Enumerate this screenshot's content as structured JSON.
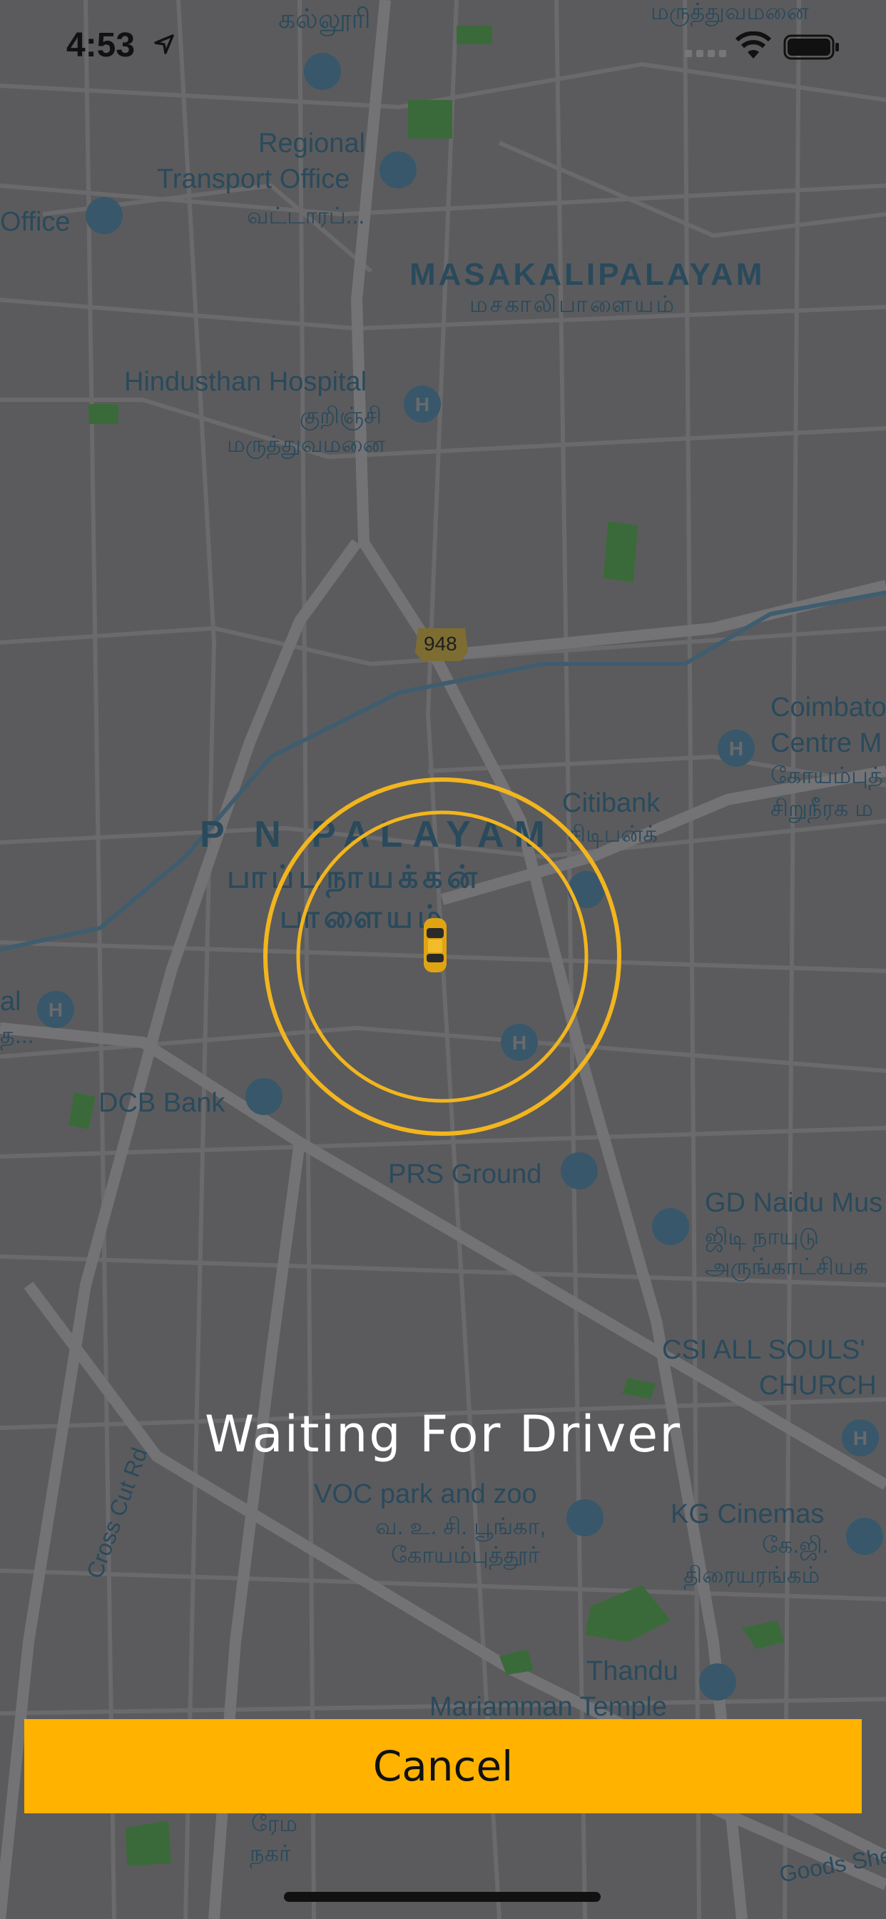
{
  "status_bar": {
    "time": "4:53"
  },
  "map": {
    "labels": {
      "top_tamil": "கல்லூரி",
      "top_right_tamil": "மருத்துவமனை",
      "regional_transport_line1": "Regional",
      "regional_transport_line2": "Transport Office",
      "regional_transport_tamil": "வட்டாரப்...",
      "office_left": "Office",
      "masakalipalayam": "MASAKALIPALAYAM",
      "masakalipalayam_tamil": "மசகாலிபாளையம்",
      "hindusthan_hospital": "Hindusthan Hospital",
      "hindusthan_tamil1": "குறிஞ்சி",
      "hindusthan_tamil2": "மருத்துவமனை",
      "road_number": "948",
      "coimbatore_line1": "Coimbato",
      "coimbatore_line2": "Centre M",
      "coimbatore_tamil1": "கோயம்புத்",
      "coimbatore_tamil2": "சிறுநீரக ம",
      "citibank": "Citibank",
      "citibank_tamil": "சிடிபன்க்",
      "pn_palayam": "P N PALAYAM",
      "pn_palayam_tamil1": "பாப்பநாயக்கன்",
      "pn_palayam_tamil2": "பாளையம்",
      "left_cut": "al",
      "left_cut2": "த...",
      "dcb_bank": "DCB Bank",
      "prs_ground": "PRS Ground",
      "gd_naidu": "GD Naidu Mus",
      "gd_naidu_tamil1": "ஜிடி நாயுடு",
      "gd_naidu_tamil2": "அருங்காட்சியக",
      "csi_line1": "CSI ALL SOULS'",
      "csi_line2": "CHURCH",
      "voc_park": "VOC park and zoo",
      "voc_tamil1": "வ. உ. சி. பூங்கா,",
      "voc_tamil2": "கோயம்புத்தூர்",
      "kg_cinemas": "KG Cinemas",
      "kg_tamil1": "கே.ஜி.",
      "kg_tamil2": "திரையரங்கம்",
      "cross_cut": "Cross Cut Rd",
      "thandu": "Thandu",
      "mariamman": "Mariamman Temple",
      "bottom_tamil1": "ரேம",
      "bottom_tamil2": "நகர்",
      "goods_shed": "Goods She"
    }
  },
  "ride": {
    "status_text": "Waiting For Driver",
    "cancel_label": "Cancel"
  },
  "colors": {
    "accent": "#FFB300",
    "overlay": "#5b5b5d",
    "ring": "#F2B51E"
  }
}
